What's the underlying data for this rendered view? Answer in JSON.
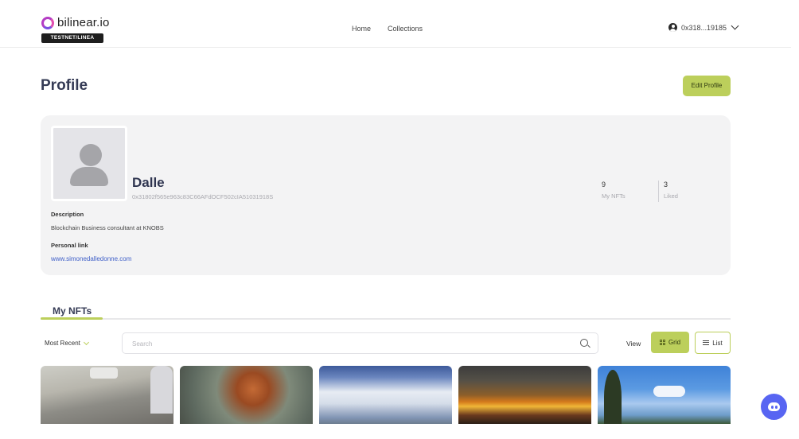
{
  "header": {
    "logo_text": "bilinear.io",
    "network_badge": "TESTNET/LINEA",
    "nav": {
      "home": "Home",
      "collections": "Collections"
    },
    "account_label": "0x318...19185"
  },
  "page": {
    "title": "Profile",
    "edit_button": "Edit Profile"
  },
  "profile": {
    "name": "Dalle",
    "address": "0x31802f565e963c83C66AFdOCF502cIA51031918S",
    "description_label": "Description",
    "description": "Blockchain Business consultant at KNOBS",
    "link_label": "Personal link",
    "link": "www.simonedalledonne.com",
    "stats": {
      "nfts_count": "9",
      "nfts_label": "My NFTs",
      "liked_count": "3",
      "liked_label": "Liked"
    }
  },
  "tabs": {
    "my_nfts": "My NFTs"
  },
  "filters": {
    "sort_label": "Most Recent",
    "search_placeholder": "Search",
    "view_label": "View",
    "grid_label": "Grid",
    "list_label": "List"
  },
  "nfts": [
    {
      "theme": "street-with-dog"
    },
    {
      "theme": "fox"
    },
    {
      "theme": "clouds-sky"
    },
    {
      "theme": "sunset"
    },
    {
      "theme": "trees-blue-sky"
    }
  ],
  "colors": {
    "accent": "#bccf5b",
    "card_bg": "#f3f3f4",
    "link": "#3f5fc8",
    "discord": "#5865f2"
  },
  "icons": [
    "logo-ring-icon",
    "user-circle-icon",
    "chevron-down-icon",
    "search-icon",
    "grid-icon",
    "list-icon",
    "discord-icon"
  ]
}
